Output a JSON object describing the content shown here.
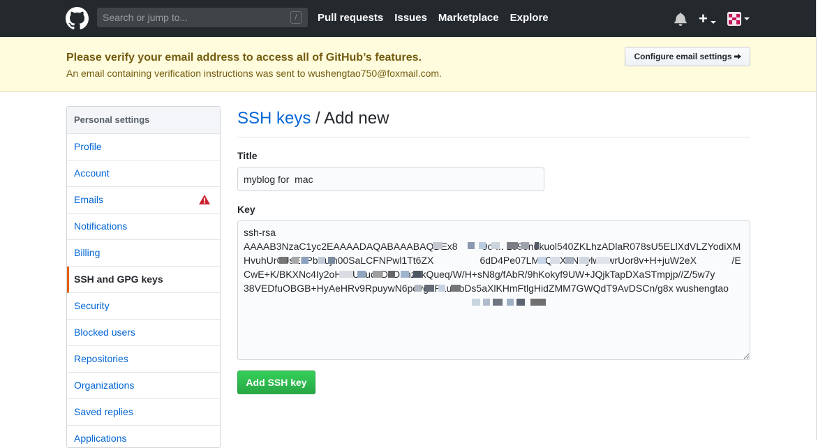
{
  "header": {
    "search_placeholder": "Search or jump to...",
    "search_shortcut": "/",
    "nav": [
      "Pull requests",
      "Issues",
      "Marketplace",
      "Explore"
    ],
    "plus_glyph": "+"
  },
  "flash": {
    "title": "Please verify your email address to access all of GitHub’s features.",
    "text": "An email containing verification instructions was sent to wushengtao750@foxmail.com.",
    "button_label": "Configure email settings"
  },
  "sidebar": {
    "heading": "Personal settings",
    "items": [
      {
        "label": "Profile"
      },
      {
        "label": "Account"
      },
      {
        "label": "Emails",
        "warning": true
      },
      {
        "label": "Notifications"
      },
      {
        "label": "Billing"
      },
      {
        "label": "SSH and GPG keys",
        "selected": true
      },
      {
        "label": "Security"
      },
      {
        "label": "Blocked users"
      },
      {
        "label": "Repositories"
      },
      {
        "label": "Organizations"
      },
      {
        "label": "Saved replies"
      },
      {
        "label": "Applications"
      }
    ]
  },
  "main": {
    "breadcrumb_link": "SSH keys",
    "breadcrumb_rest": " / Add new",
    "title_label": "Title",
    "title_value": "myblog for  mac",
    "key_label": "Key",
    "key_value": "ssh-rsa\nAAAAB3NzaC1yc2EAAAADAQABAAABAQDEx8         9o ... 109enukuol540ZKLhzADlaR078sU5ELlXdVLZYodiXM            HvuhUrGJsELPbXujn00SaLCFNPwl1Tt6ZX                 6dD4Pe07LMbQUXuNCylwOwrUor8v+H+juW2eX             /ECwE+K/BKXNc4Iy2oHLaU+udcDkD5hzhkQueq/W/H+sN8g/fAbR/9hKokyf9UW+JQjkTapDXaSTmpjp//Z/5w7y          38VEDfuOBGB+HyAeHRv9RpuywN6povgZPLuHbDs5aXlKHmFtlgHidZMM7GWQdT9AvDSCn/g8x wushengtao",
    "submit_label": "Add SSH key"
  }
}
